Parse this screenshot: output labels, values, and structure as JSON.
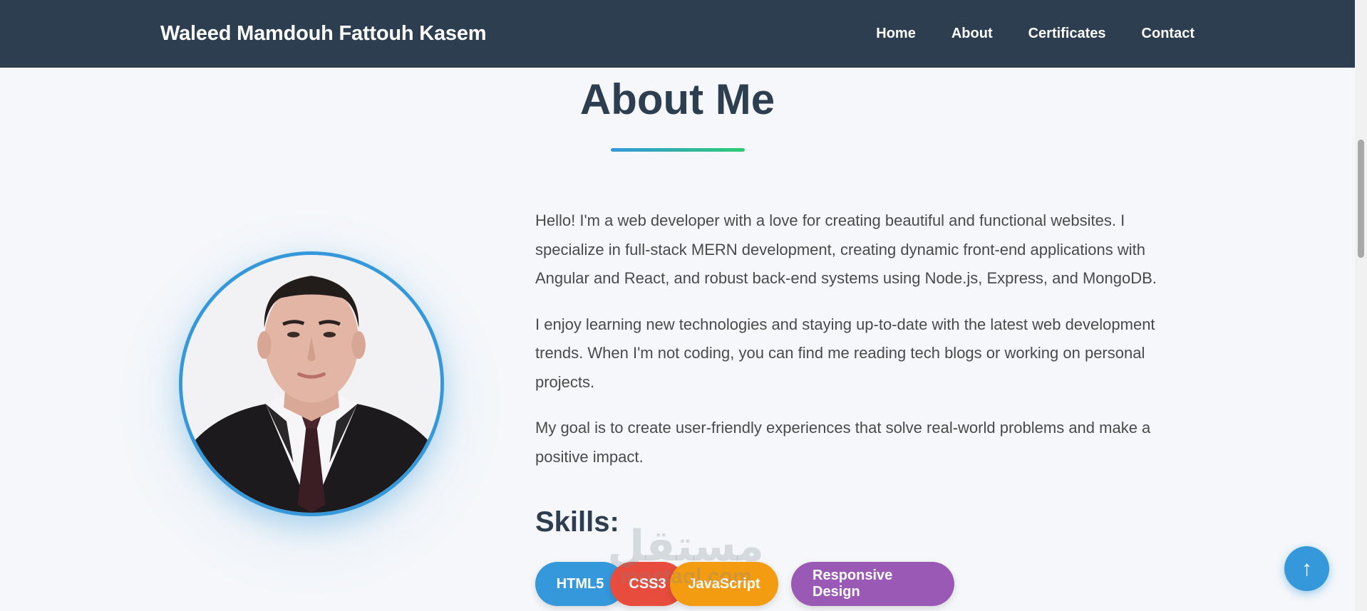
{
  "nav": {
    "brand": "Waleed Mamdouh Fattouh Kasem",
    "links": [
      "Home",
      "About",
      "Certificates",
      "Contact"
    ]
  },
  "about": {
    "title": "About Me",
    "paragraphs": [
      "Hello! I'm a web developer with a love for creating beautiful and functional websites. I specialize in full-stack MERN development, creating dynamic front-end applications with Angular and React, and robust back-end systems using Node.js, Express, and MongoDB.",
      "I enjoy learning new technologies and staying up-to-date with the latest web development trends. When I'm not coding, you can find me reading tech blogs or working on personal projects.",
      "My goal is to create user-friendly experiences that solve real-world problems and make a positive impact."
    ],
    "skills_heading": "Skills:",
    "skills": [
      {
        "label": "HTML5",
        "color": "#3498db"
      },
      {
        "label": "CSS3",
        "color": "#e74c3c"
      },
      {
        "label": "JavaScript",
        "color": "#f39c12"
      },
      {
        "label": "Responsive Design",
        "color": "#9b59b6"
      }
    ]
  },
  "watermark": {
    "arabic": "مستقل",
    "latin": "mostaql.com"
  },
  "back_to_top": {
    "icon": "arrow-up-icon",
    "glyph": "↑"
  },
  "colors": {
    "navbar": "#2c3e50",
    "accent": "#3498db",
    "accent_green": "#2ecc71",
    "background": "#f5f7fa"
  }
}
